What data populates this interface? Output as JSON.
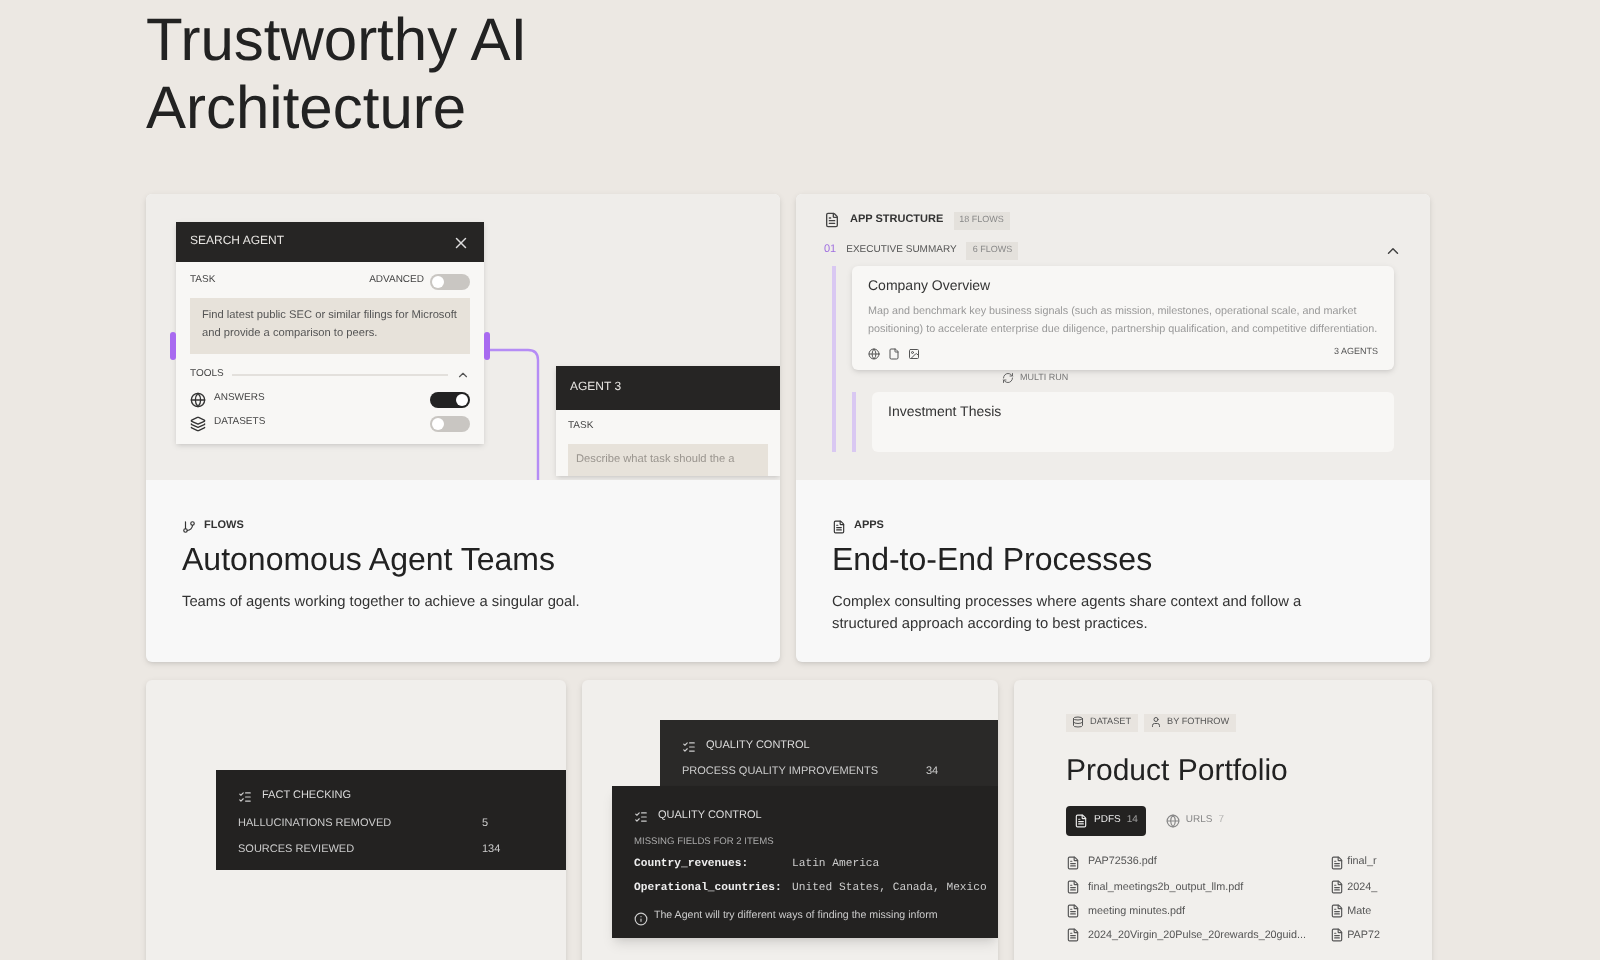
{
  "heading": {
    "lines": [
      "Trustworthy AI",
      "Architecture"
    ]
  },
  "agents_card": {
    "tag": "FLOWS",
    "title": "Autonomous Agent Teams",
    "description": "Teams of agents working together to achieve a singular goal.",
    "search_agent": {
      "title": "SEARCH AGENT",
      "task_label": "TASK",
      "advanced": {
        "label": "ADVANCED",
        "on": false
      },
      "task_text": "Find latest public SEC or similar filings for Microsoft and provide a comparison to peers.",
      "tools_label": "TOOLS",
      "tools_expanded": true,
      "tools": [
        {
          "kind": "globe",
          "name": "ANSWERS",
          "on": true
        },
        {
          "kind": "stack",
          "name": "DATASETS",
          "on": false
        }
      ]
    },
    "agent_3": {
      "title": "AGENT 3",
      "task_label": "TASK",
      "placeholder": "Describe what task should the a"
    }
  },
  "apps_card": {
    "tag": "APPS",
    "title": "End-to-End Processes",
    "description": "Complex consulting processes where agents share context and follow a structured approach according to best practices.",
    "structure": {
      "label": "APP STRUCTURE",
      "count": "18 FLOWS"
    },
    "section": {
      "number": "01",
      "label": "EXECUTIVE SUMMARY",
      "count": "6 FLOWS",
      "expanded": true
    },
    "flow": {
      "title": "Company Overview",
      "description": "Map and benchmark key business signals (such as mission, milestones, operational scale, and market positioning) to accelerate enterprise due diligence, partnership qualification, and competitive differentiation.",
      "agents": "3 AGENTS"
    },
    "multi_run": "MULTI RUN",
    "next_flow": {
      "title": "Investment Thesis"
    }
  },
  "fact_checking": {
    "title": "FACT CHECKING",
    "rows": [
      {
        "label": "HALLUCINATIONS REMOVED",
        "value": "5"
      },
      {
        "label": "SOURCES REVIEWED",
        "value": "134"
      }
    ]
  },
  "quality_back": {
    "title": "QUALITY CONTROL",
    "rows": [
      {
        "label": "PROCESS QUALITY IMPROVEMENTS",
        "value": "34"
      }
    ]
  },
  "quality_front": {
    "title": "QUALITY CONTROL",
    "subtitle": "MISSING FIELDS FOR 2 ITEMS",
    "fields": [
      {
        "name": "Country_revenues:",
        "value": "Latin America"
      },
      {
        "name": "Operational_countries:",
        "value": "United States, Canada, Mexico"
      }
    ],
    "note": "The Agent will try different ways of finding the missing inform"
  },
  "portfolio": {
    "tags": [
      {
        "kind": "dataset",
        "label": "DATASET"
      },
      {
        "kind": "person",
        "label": "BY FOTHROW"
      }
    ],
    "title": "Product Portfolio",
    "tabs": [
      {
        "kind": "file",
        "label": "PDFS",
        "count": "14",
        "selected": true
      },
      {
        "kind": "globe",
        "label": "URLS",
        "count": "7",
        "selected": false
      }
    ],
    "files": [
      "PAP72536.pdf",
      "final_meetings2b_output_llm.pdf",
      "meeting minutes.pdf",
      "2024_20Virgin_20Pulse_20rewards_20guid..."
    ],
    "files_column_2": [
      "final_r",
      "2024_",
      "Mate",
      "PAP72"
    ]
  }
}
